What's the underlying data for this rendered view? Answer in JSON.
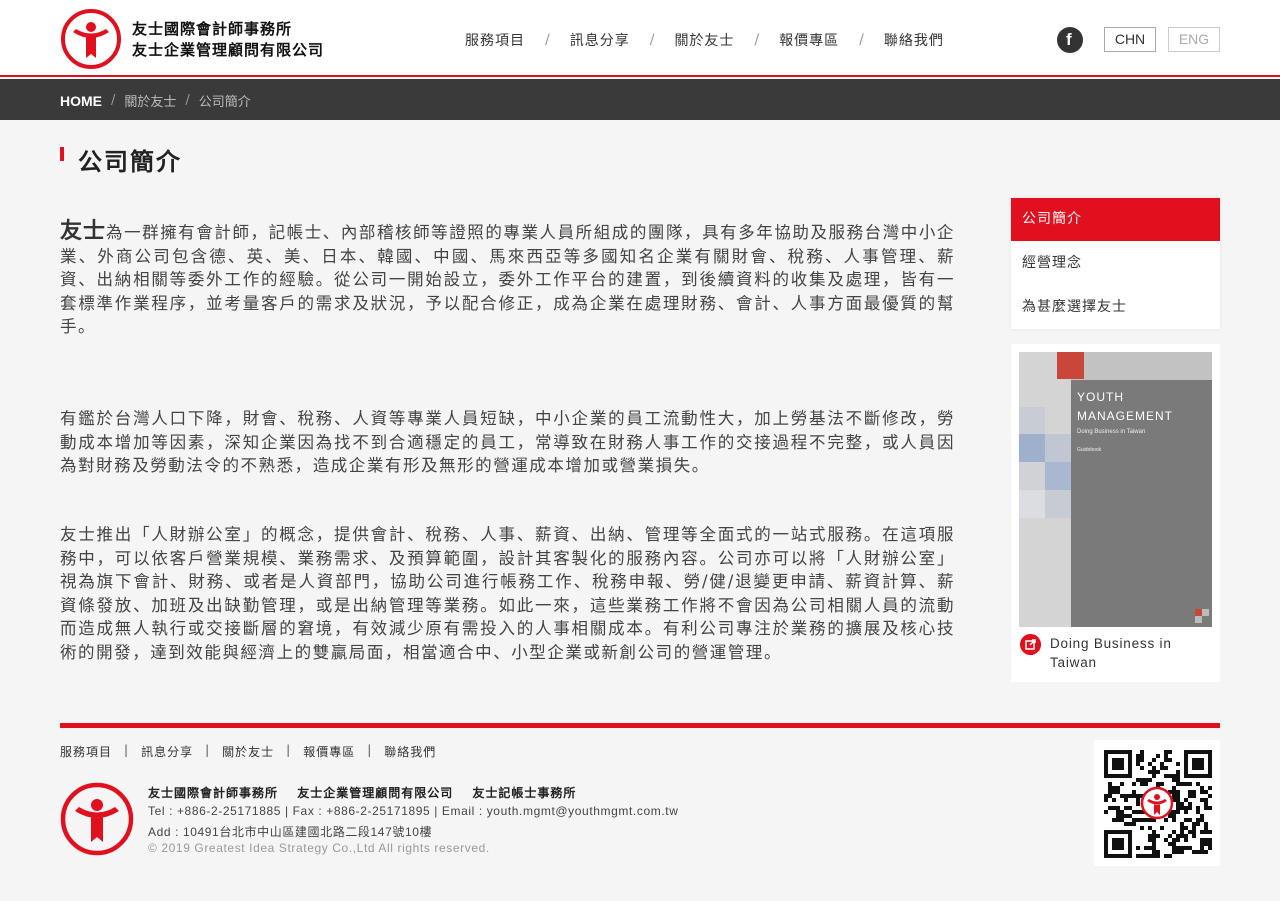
{
  "header": {
    "brand_line1": "友士國際會計師事務所",
    "brand_line2": "友士企業管理顧問有限公司",
    "nav": [
      "服務項目",
      "訊息分享",
      "關於友士",
      "報價專區",
      "聯絡我們"
    ],
    "nav_separator": "/",
    "facebook_glyph": "f",
    "lang_chn": "CHN",
    "lang_eng": "ENG"
  },
  "breadcrumb": {
    "home": "HOME",
    "separator": "/",
    "level1": "關於友士",
    "level2": "公司簡介"
  },
  "page": {
    "title": "公司簡介",
    "p1_lead": "友士",
    "p1_rest": "為一群擁有會計師，記帳士、內部稽核師等證照的專業人員所組成的團隊，具有多年協助及服務台灣中小企業、外商公司包含德、英、美、日本、韓國、中國、馬來西亞等多國知名企業有關財會、稅務、人事管理、薪資、出納相關等委外工作的經驗。從公司一開始設立，委外工作平台的建置，到後續資料的收集及處理，皆有一套標準作業程序，並考量客戶的需求及狀況，予以配合修正，成為企業在處理財務、會計、人事方面最優質的幫手。",
    "p2": "有鑑於台灣人口下降，財會、稅務、人資等專業人員短缺，中小企業的員工流動性大，加上勞基法不斷修改，勞動成本增加等因素，深知企業因為找不到合適穩定的員工，常導致在財務人事工作的交接過程不完整，或人員因為對財務及勞動法令的不熟悉，造成企業有形及無形的營運成本增加或營業損失。",
    "p3": "友士推出「人財辦公室」的概念，提供會計、稅務、人事、薪資、出納、管理等全面式的一站式服務。在這項服務中，可以依客戶營業規模、業務需求、及預算範圍，設計其客製化的服務內容。公司亦可以將「人財辦公室」視為旗下會計、財務、或者是人資部門，協助公司進行帳務工作、稅務申報、勞/健/退變更申請、薪資計算、薪資條發放、加班及出缺勤管理，或是出納管理等業務。如此一來，這些業務工作將不會因為公司相關人員的流動而造成無人執行或交接斷層的窘境，有效減少原有需投入的人事相關成本。有利公司專注於業務的擴展及核心技術的開發，達到效能與經濟上的雙贏局面，相當適合中、小型企業或新創公司的營運管理。"
  },
  "sidebar": {
    "items": [
      "公司簡介",
      "經營理念",
      "為甚麼選擇友士"
    ],
    "book_title_line1": "YOUTH",
    "book_title_line2": "MANAGEMENT",
    "book_subtitle": "Doing Business in Taiwan",
    "book_tag": "Guidebook",
    "book_caption": "Doing Business in Taiwan"
  },
  "footer": {
    "nav": [
      "服務項目",
      "訊息分享",
      "關於友士",
      "報價專區",
      "聯絡我們"
    ],
    "nav_separator": "|",
    "names": [
      "友士國際會計師事務所",
      "友士企業管理顧問有限公司",
      "友士記帳士事務所"
    ],
    "tel_line": "Tel : +886-2-25171885 | Fax : +886-2-25171895 | Email :  youth.mgmt@youthmgmt.com.tw",
    "addr_line": "Add : 10491台北市中山區建國北路二段147號10樓",
    "copyright": "© 2019 Greatest Idea Strategy Co.,Ltd All rights reserved."
  },
  "colors": {
    "brand_red": "#e0101e",
    "dark_bar": "#3a3a3a",
    "page_bg": "#f5f5f5"
  }
}
